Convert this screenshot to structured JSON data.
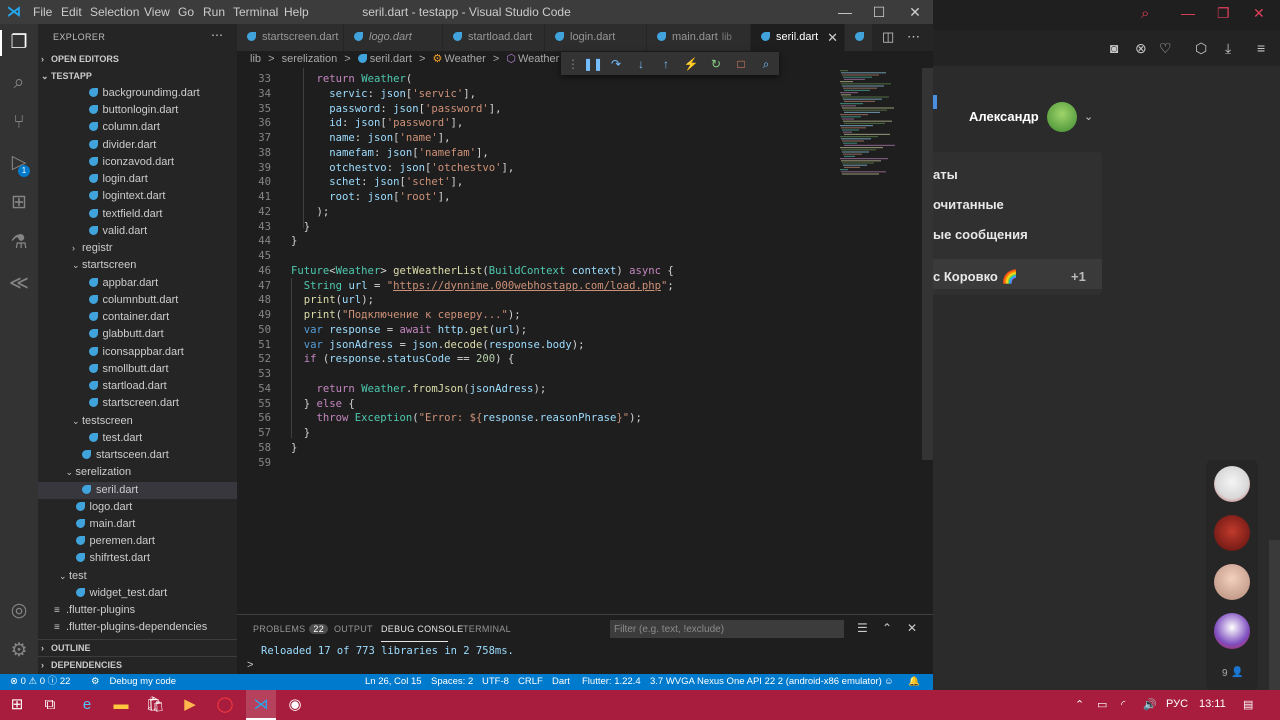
{
  "colors": {
    "vscode_bg": "#1e1e1e",
    "sidebar_bg": "#252526",
    "statusbar": "#007acc",
    "taskbar": "#a81d3e",
    "dart": "#40a3dc"
  },
  "titlebar": {
    "menu": [
      "File",
      "Edit",
      "Selection",
      "View",
      "Go",
      "Run",
      "Terminal",
      "Help"
    ],
    "title": "seril.dart - testapp - Visual Studio Code"
  },
  "explorer": {
    "header": "EXPLORER",
    "open_editors": "OPEN EDITORS",
    "project": "TESTAPP",
    "items": [
      {
        "label": "backgroundimg.dart",
        "type": "dart",
        "indent": 3
      },
      {
        "label": "buttonlogin.dart",
        "type": "dart",
        "indent": 3
      },
      {
        "label": "column.dart",
        "type": "dart",
        "indent": 3
      },
      {
        "label": "divider.dart",
        "type": "dart",
        "indent": 3
      },
      {
        "label": "iconzavod.dart",
        "type": "dart",
        "indent": 3
      },
      {
        "label": "login.dart",
        "type": "dart",
        "indent": 3
      },
      {
        "label": "logintext.dart",
        "type": "dart",
        "indent": 3
      },
      {
        "label": "textfield.dart",
        "type": "dart",
        "indent": 3
      },
      {
        "label": "valid.dart",
        "type": "dart",
        "indent": 3
      },
      {
        "label": "registr",
        "type": "folder-closed",
        "indent": 2
      },
      {
        "label": "startscreen",
        "type": "folder-open",
        "indent": 2
      },
      {
        "label": "appbar.dart",
        "type": "dart",
        "indent": 3
      },
      {
        "label": "columnbutt.dart",
        "type": "dart",
        "indent": 3
      },
      {
        "label": "container.dart",
        "type": "dart",
        "indent": 3
      },
      {
        "label": "glabbutt.dart",
        "type": "dart",
        "indent": 3
      },
      {
        "label": "iconsappbar.dart",
        "type": "dart",
        "indent": 3
      },
      {
        "label": "smollbutt.dart",
        "type": "dart",
        "indent": 3
      },
      {
        "label": "startload.dart",
        "type": "dart",
        "indent": 3
      },
      {
        "label": "startscreen.dart",
        "type": "dart",
        "indent": 3
      },
      {
        "label": "testscreen",
        "type": "folder-open",
        "indent": 2
      },
      {
        "label": "test.dart",
        "type": "dart",
        "indent": 3
      },
      {
        "label": "startsceen.dart",
        "type": "dart",
        "indent": 2
      },
      {
        "label": "serelization",
        "type": "folder-open",
        "indent": 1
      },
      {
        "label": "seril.dart",
        "type": "dart",
        "indent": 2,
        "selected": true
      },
      {
        "label": "logo.dart",
        "type": "dart",
        "indent": 1
      },
      {
        "label": "main.dart",
        "type": "dart",
        "indent": 1
      },
      {
        "label": "peremen.dart",
        "type": "dart",
        "indent": 1
      },
      {
        "label": "shifrtest.dart",
        "type": "dart",
        "indent": 1
      },
      {
        "label": "test",
        "type": "folder-open",
        "indent": 0
      },
      {
        "label": "widget_test.dart",
        "type": "dart",
        "indent": 1
      },
      {
        "label": ".flutter-plugins",
        "type": "file",
        "indent": 0
      },
      {
        "label": ".flutter-plugins-dependencies",
        "type": "file",
        "indent": 0
      }
    ],
    "outline": "OUTLINE",
    "dependencies": "DEPENDENCIES"
  },
  "tabs": [
    {
      "label": "startscreen.dart",
      "italic": false
    },
    {
      "label": "logo.dart",
      "italic": true
    },
    {
      "label": "startload.dart",
      "italic": false
    },
    {
      "label": "login.dart",
      "italic": false
    },
    {
      "label": "main.dart",
      "sub": "lib",
      "italic": false
    },
    {
      "label": "seril.dart",
      "italic": false,
      "active": true
    }
  ],
  "breadcrumb": [
    "lib",
    ">",
    "serelization",
    ">",
    "seril.dart",
    ">",
    "Weather",
    ">",
    "Weather"
  ],
  "editor": {
    "lines": [
      {
        "n": "33",
        "code": "    <span class=\"kw\">return</span> <span class=\"ty\">Weather</span>("
      },
      {
        "n": "34",
        "code": "      <span class=\"var\">servic</span>: <span class=\"var\">json</span>[<span class=\"str\">'servic'</span>],"
      },
      {
        "n": "35",
        "code": "      <span class=\"var\">password</span>: <span class=\"var\">json</span>[<span class=\"str\">'password'</span>],"
      },
      {
        "n": "36",
        "code": "      <span class=\"var\">id</span>: <span class=\"var\">json</span>[<span class=\"str\">'password'</span>],"
      },
      {
        "n": "37",
        "code": "      <span class=\"var\">name</span>: <span class=\"var\">json</span>[<span class=\"str\">'name'</span>],"
      },
      {
        "n": "38",
        "code": "      <span class=\"var\">namefam</span>: <span class=\"var\">json</span>[<span class=\"str\">'namefam'</span>],"
      },
      {
        "n": "39",
        "code": "      <span class=\"var\">otchestvo</span>: <span class=\"var\">json</span>[<span class=\"str\">'otchestvo'</span>],"
      },
      {
        "n": "40",
        "code": "      <span class=\"var\">schet</span>: <span class=\"var\">json</span>[<span class=\"str\">'schet'</span>],"
      },
      {
        "n": "41",
        "code": "      <span class=\"var\">root</span>: <span class=\"var\">json</span>[<span class=\"str\">'root'</span>],"
      },
      {
        "n": "42",
        "code": "    );"
      },
      {
        "n": "43",
        "code": "  }"
      },
      {
        "n": "44",
        "code": "}"
      },
      {
        "n": "45",
        "code": ""
      },
      {
        "n": "46",
        "code": "<span class=\"ty\">Future</span>&lt;<span class=\"ty\">Weather</span>&gt; <span class=\"fn\">getWeatherList</span>(<span class=\"ty\">BuildContext</span> <span class=\"var\">context</span>) <span class=\"kw\">async</span> {"
      },
      {
        "n": "47",
        "code": "  <span class=\"ty\">String</span> <span class=\"var\">url</span> = <span class=\"str\">\"</span><span class=\"url\">https://dynnime.000webhostapp.com/load.php</span><span class=\"str\">\"</span>;"
      },
      {
        "n": "48",
        "code": "  <span class=\"fn\">print</span>(<span class=\"var\">url</span>);"
      },
      {
        "n": "49",
        "code": "  <span class=\"fn\">print</span>(<span class=\"str\">\"Подключение к серверу...\"</span>);"
      },
      {
        "n": "50",
        "code": "  <span class=\"kw2\">var</span> <span class=\"var\">response</span> = <span class=\"kw\">await</span> <span class=\"var\">http</span>.<span class=\"fn\">get</span>(<span class=\"var\">url</span>);"
      },
      {
        "n": "51",
        "code": "  <span class=\"kw2\">var</span> <span class=\"var\">jsonAdress</span> = <span class=\"var\">json</span>.<span class=\"fn\">decode</span>(<span class=\"var\">response</span>.<span class=\"var\">body</span>);"
      },
      {
        "n": "52",
        "code": "  <span class=\"kw\">if</span> (<span class=\"var\">response</span>.<span class=\"var\">statusCode</span> == <span class=\"num\">200</span>) {"
      },
      {
        "n": "53",
        "code": ""
      },
      {
        "n": "54",
        "code": "    <span class=\"kw\">return</span> <span class=\"ty\">Weather</span>.<span class=\"fn\">fromJson</span>(<span class=\"var\">jsonAdress</span>);"
      },
      {
        "n": "55",
        "code": "  } <span class=\"kw\">else</span> {"
      },
      {
        "n": "56",
        "code": "    <span class=\"kw\">throw</span> <span class=\"ty\">Exception</span>(<span class=\"str\">\"Error: ${</span><span class=\"var\">response</span>.<span class=\"var\">reasonPhrase</span><span class=\"str\">}\"</span>);"
      },
      {
        "n": "57",
        "code": "  }"
      },
      {
        "n": "58",
        "code": "}"
      },
      {
        "n": "59",
        "code": ""
      }
    ]
  },
  "panel": {
    "problems": "PROBLEMS",
    "problems_count": "22",
    "output": "OUTPUT",
    "debug_console": "DEBUG CONSOLE",
    "terminal": "TERMINAL",
    "filter_placeholder": "Filter (e.g. text, !exclude)",
    "console_line": "Reloaded 17 of 773 libraries in 2 758ms.",
    "prompt": ">"
  },
  "statusbar": {
    "errors": "0",
    "warnings": "0",
    "infos": "22",
    "debug": "Debug my code",
    "position": "Ln 26, Col 15",
    "spaces": "Spaces: 2",
    "encoding": "UTF-8",
    "eol": "CRLF",
    "language": "Dart",
    "flutter": "Flutter: 1.22.4",
    "device": "3.7 WVGA Nexus One API 22 2 (android-x86 emulator)"
  },
  "bgapp": {
    "user": "Александр",
    "menu": [
      "аты",
      "очитанные",
      "ые сообщения",
      "с Коровко 🌈"
    ],
    "plus": "+1",
    "count": "9"
  },
  "taskbar": {
    "lang": "РУС",
    "time": "13:11"
  }
}
